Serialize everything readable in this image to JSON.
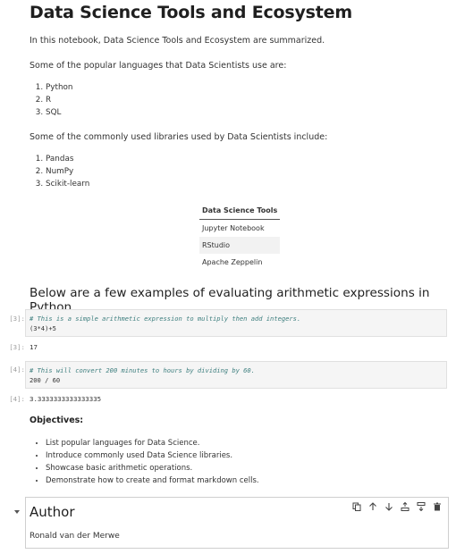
{
  "title": "Data Science Tools and Ecosystem",
  "intro": "In this notebook, Data Science Tools and Ecosystem are summarized.",
  "languages": {
    "heading": "Some of the popular languages that Data Scientists use are:",
    "items": [
      "Python",
      "R",
      "SQL"
    ]
  },
  "libraries": {
    "heading": "Some of the commonly used libraries used by Data Scientists include:",
    "items": [
      "Pandas",
      "NumPy",
      "Scikit-learn"
    ]
  },
  "tools_table": {
    "header": "Data Science Tools",
    "rows": [
      "Jupyter Notebook",
      "RStudio",
      "Apache Zeppelin"
    ]
  },
  "arith_heading": "Below are a few examples of evaluating arithmetic expressions in Python.",
  "cell1": {
    "prompt_in": "[3]:",
    "comment": "# This is a simple arithmetic expression to multiply then add integers.",
    "code": "(3*4)+5",
    "prompt_out": "[3]:",
    "output": "17"
  },
  "cell2": {
    "prompt_in": "[4]:",
    "comment": "# This will convert 200 minutes to hours by dividing by 60.",
    "code": "200 / 60",
    "prompt_out": "[4]:",
    "output": "3.3333333333333335"
  },
  "objectives": {
    "heading": "Objectives:",
    "items": [
      "List popular languages for Data Science.",
      "Introduce commonly used Data Science libraries.",
      "Showcase basic arithmetic operations.",
      "Demonstrate how to create and format markdown cells."
    ]
  },
  "author_cell": {
    "heading": "Author",
    "name": "Ronald van der Merwe",
    "toolbar_icons": [
      "duplicate-icon",
      "move-up-icon",
      "move-down-icon",
      "insert-above-icon",
      "insert-below-icon",
      "delete-icon"
    ]
  },
  "colors": {
    "code_bg": "#f5f5f5",
    "comment": "#408080",
    "prompt": "#9e9e9e"
  }
}
